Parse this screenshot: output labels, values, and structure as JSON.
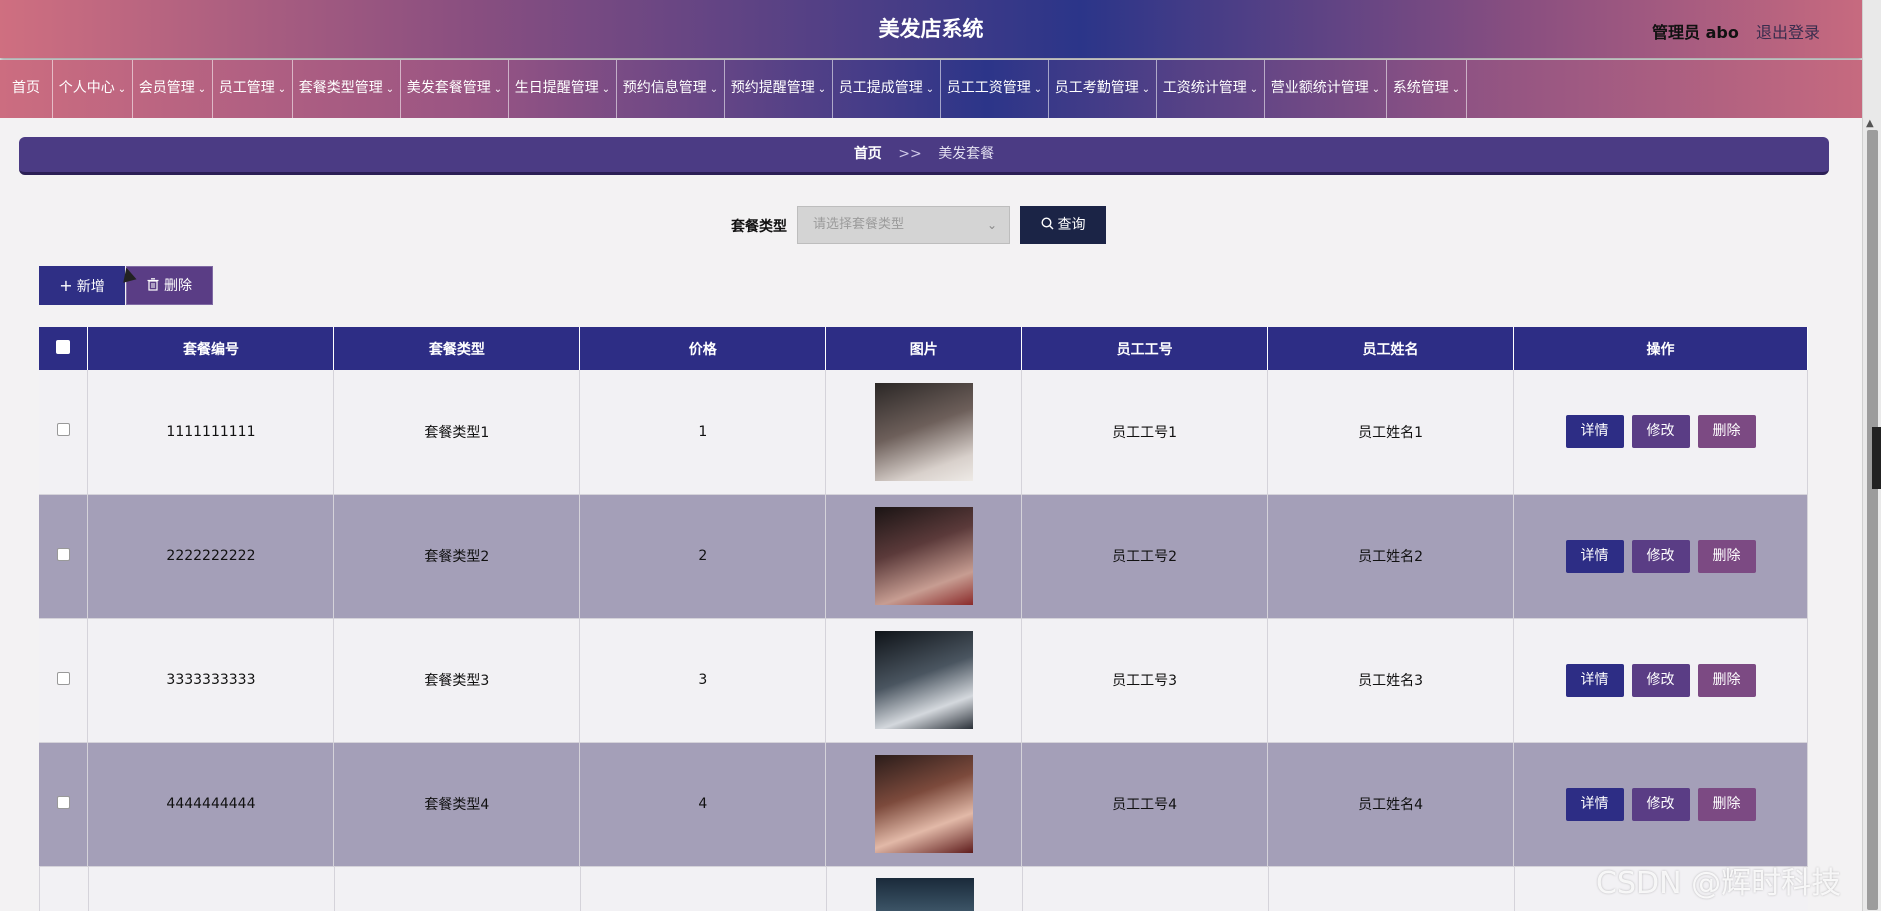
{
  "header": {
    "title": "美发店系统",
    "user": "管理员 abo",
    "logout": "退出登录"
  },
  "nav": [
    {
      "label": "首页",
      "dropdown": false
    },
    {
      "label": "个人中心",
      "dropdown": true
    },
    {
      "label": "会员管理",
      "dropdown": true
    },
    {
      "label": "员工管理",
      "dropdown": true
    },
    {
      "label": "套餐类型管理",
      "dropdown": true
    },
    {
      "label": "美发套餐管理",
      "dropdown": true
    },
    {
      "label": "生日提醒管理",
      "dropdown": true
    },
    {
      "label": "预约信息管理",
      "dropdown": true
    },
    {
      "label": "预约提醒管理",
      "dropdown": true
    },
    {
      "label": "员工提成管理",
      "dropdown": true
    },
    {
      "label": "员工工资管理",
      "dropdown": true
    },
    {
      "label": "员工考勤管理",
      "dropdown": true
    },
    {
      "label": "工资统计管理",
      "dropdown": true
    },
    {
      "label": "营业额统计管理",
      "dropdown": true
    },
    {
      "label": "系统管理",
      "dropdown": true
    }
  ],
  "breadcrumb": {
    "home": "首页",
    "sep": ">>",
    "current": "美发套餐"
  },
  "search": {
    "label": "套餐类型",
    "placeholder": "请选择套餐类型",
    "query_label": "查询"
  },
  "toolbar": {
    "add_label": "新增",
    "delete_label": "删除"
  },
  "table": {
    "headers": [
      "套餐编号",
      "套餐类型",
      "价格",
      "图片",
      "员工工号",
      "员工姓名",
      "操作"
    ],
    "actions": {
      "detail": "详情",
      "edit": "修改",
      "delete": "删除"
    },
    "rows": [
      {
        "code": "1111111111",
        "type": "套餐类型1",
        "price": "1",
        "emp_no": "员工工号1",
        "emp_name": "员工姓名1"
      },
      {
        "code": "2222222222",
        "type": "套餐类型2",
        "price": "2",
        "emp_no": "员工工号2",
        "emp_name": "员工姓名2"
      },
      {
        "code": "3333333333",
        "type": "套餐类型3",
        "price": "3",
        "emp_no": "员工工号3",
        "emp_name": "员工姓名3"
      },
      {
        "code": "4444444444",
        "type": "套餐类型4",
        "price": "4",
        "emp_no": "员工工号4",
        "emp_name": "员工姓名4"
      }
    ]
  },
  "watermark": "CSDN @辉时科技"
}
